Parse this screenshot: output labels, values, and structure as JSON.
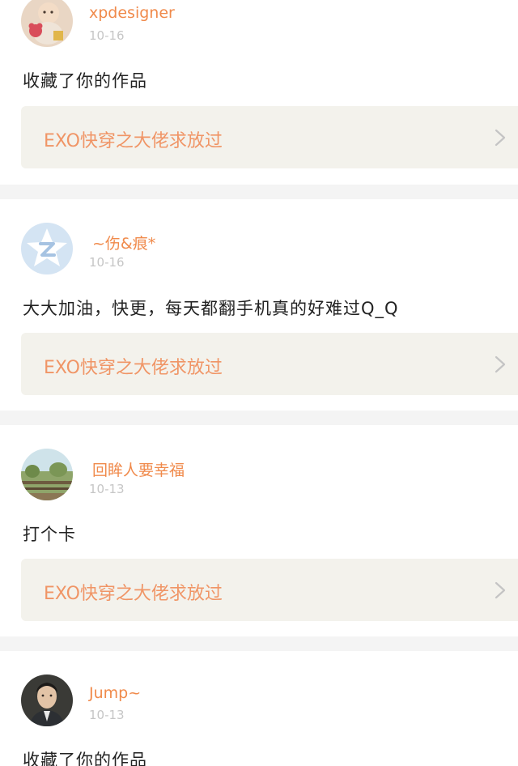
{
  "feed": {
    "items": [
      {
        "username": "xpdesigner",
        "date": "10-16",
        "comment": "收藏了你的作品",
        "work_title": "EXO快穿之大佬求放过",
        "avatar_icon": "baby-photo-avatar-icon"
      },
      {
        "username": "~伤&痕*",
        "date": "10-16",
        "comment": "大大加油，快更，每天都翻手机真的好难过Q_Q",
        "work_title": "EXO快穿之大佬求放过",
        "avatar_icon": "default-qq-avatar-icon"
      },
      {
        "username": "回眸人要幸福",
        "date": "10-13",
        "comment": "打个卡",
        "work_title": "EXO快穿之大佬求放过",
        "avatar_icon": "landscape-photo-avatar-icon"
      },
      {
        "username": "Jump~",
        "date": "10-13",
        "comment": "收藏了你的作品",
        "avatar_icon": "portrait-photo-avatar-icon"
      }
    ]
  },
  "colors": {
    "username": "#f08a4b",
    "work_title": "#f09566",
    "card_bg": "#f3f2ec",
    "date": "#c6c6c6",
    "divider": "#f4f4f4"
  }
}
